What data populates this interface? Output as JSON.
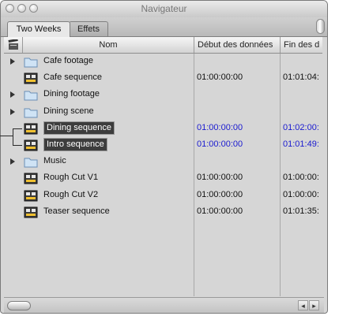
{
  "window": {
    "title": "Navigateur"
  },
  "tabs": [
    {
      "label": "Two Weeks",
      "active": true
    },
    {
      "label": "Effets",
      "active": false
    }
  ],
  "columns": {
    "icon": "clapper-icon",
    "name": "Nom",
    "start": "Début des données",
    "end": "Fin des d"
  },
  "rows": [
    {
      "icon": "folder-icon",
      "disclosure": true,
      "name": "Cafe footage",
      "start": "",
      "end": ""
    },
    {
      "icon": "sequence-icon",
      "disclosure": false,
      "name": "Cafe sequence",
      "start": "01:00:00:00",
      "end": "01:01:04:"
    },
    {
      "icon": "folder-icon",
      "disclosure": true,
      "name": "Dining footage",
      "start": "",
      "end": ""
    },
    {
      "icon": "folder-icon",
      "disclosure": true,
      "name": "Dining scene",
      "start": "",
      "end": ""
    },
    {
      "icon": "sequence-icon",
      "disclosure": false,
      "name": "Dining sequence",
      "start": "01:00:00:00",
      "end": "01:02:00:",
      "selected": true
    },
    {
      "icon": "sequence-icon",
      "disclosure": false,
      "name": "Intro sequence",
      "start": "01:00:00:00",
      "end": "01:01:49:",
      "selected": true
    },
    {
      "icon": "folder-icon",
      "disclosure": true,
      "name": "Music",
      "start": "",
      "end": ""
    },
    {
      "icon": "sequence-icon",
      "disclosure": false,
      "name": "Rough Cut V1",
      "start": "01:00:00:00",
      "end": "01:00:00:"
    },
    {
      "icon": "sequence-icon",
      "disclosure": false,
      "name": "Rough Cut V2",
      "start": "01:00:00:00",
      "end": "01:00:00:"
    },
    {
      "icon": "sequence-icon",
      "disclosure": false,
      "name": "Teaser sequence",
      "start": "01:00:00:00",
      "end": "01:01:35:"
    }
  ],
  "colors": {
    "selected_bg": "#3d3d3d",
    "selected_text": "#ffffff",
    "selected_timecode": "#1a1ad0",
    "list_bg": "#d6d6d6"
  },
  "scrollbar": {
    "left_arrow": "◂",
    "right_arrow": "▸"
  }
}
